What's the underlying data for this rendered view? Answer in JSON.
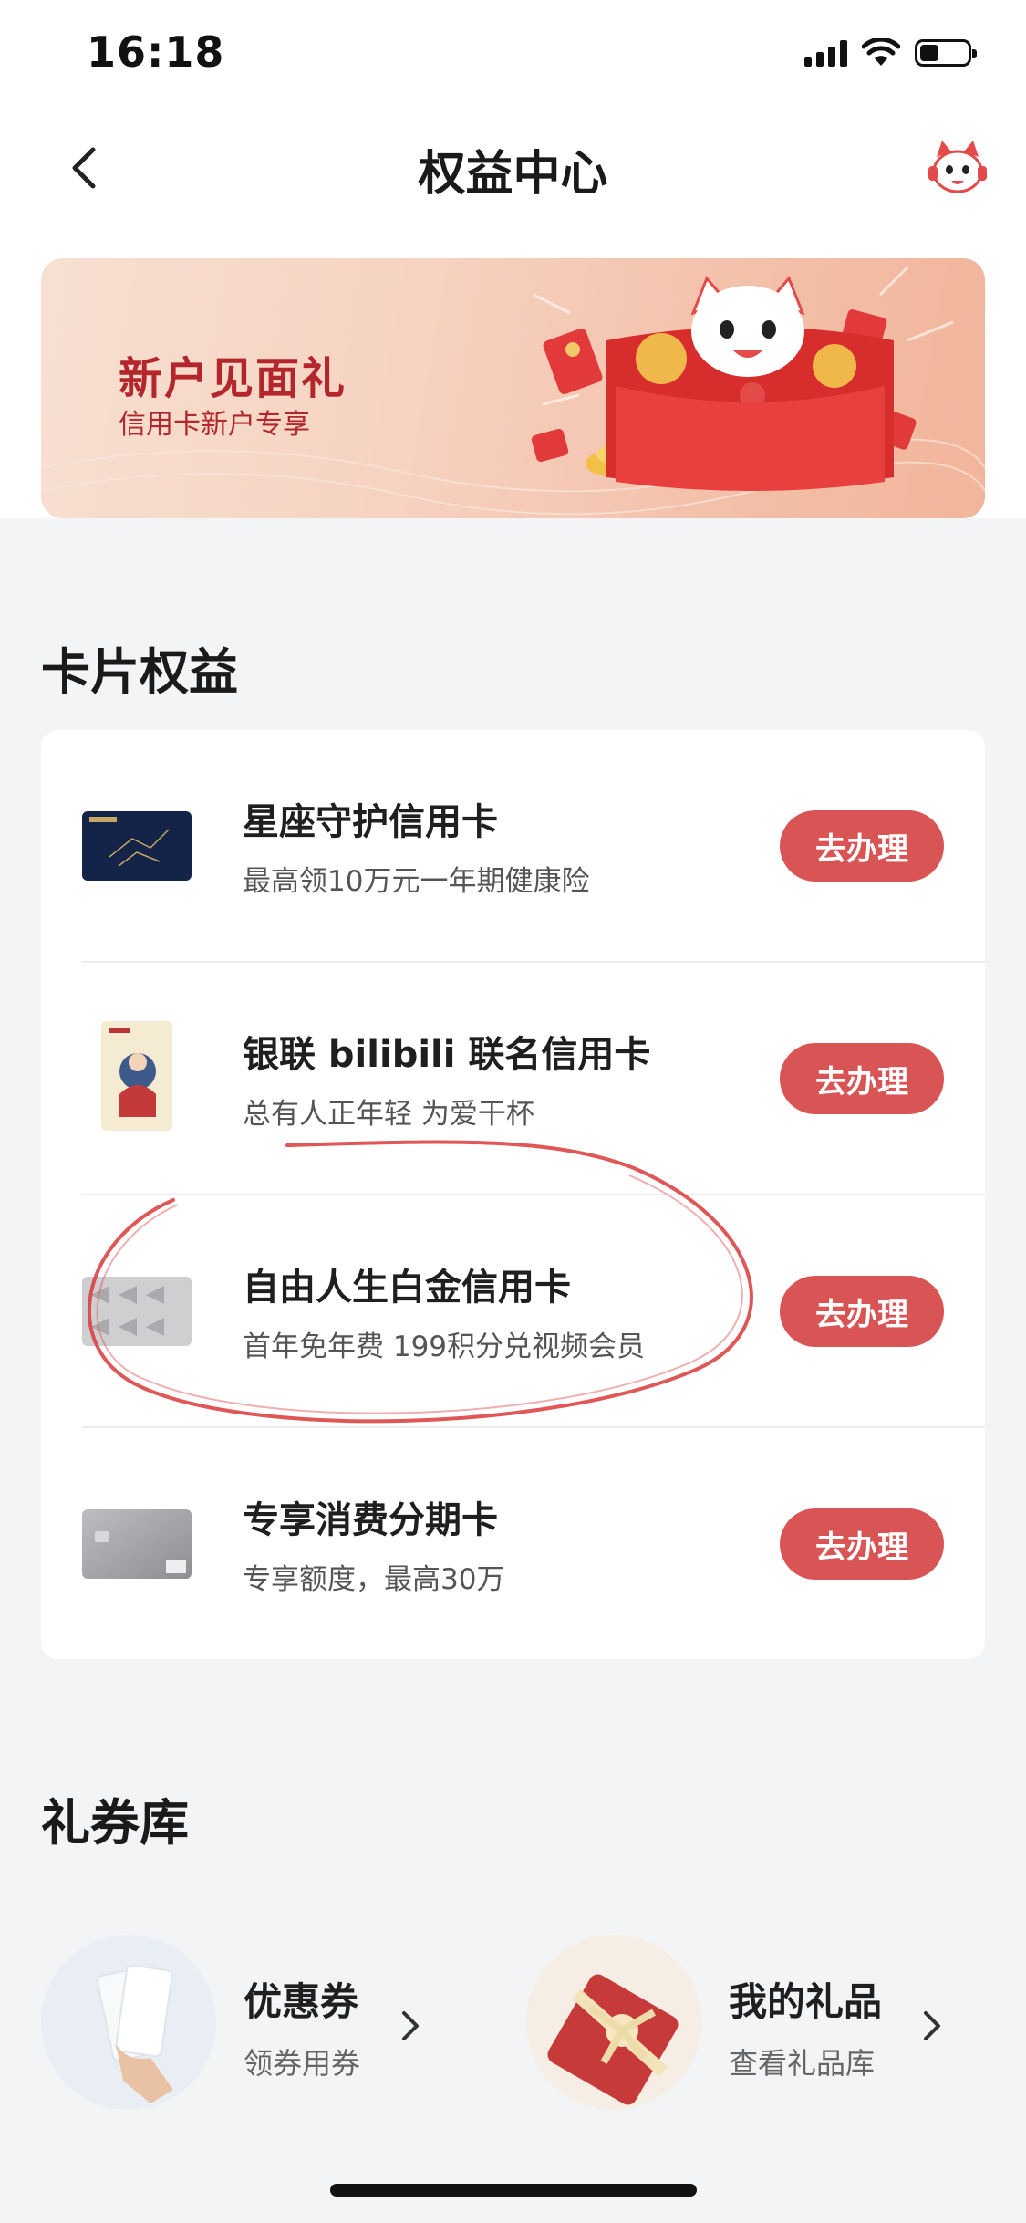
{
  "status_bar": {
    "time": "16:18",
    "battery_level": 0.4
  },
  "nav": {
    "title": "权益中心",
    "back_icon": "chevron-left-icon",
    "mascot_icon": "cat-mascot-icon"
  },
  "banner": {
    "title": "新户见面礼",
    "subtitle": "信用卡新户专享"
  },
  "card_section": {
    "title": "卡片权益",
    "cards": [
      {
        "name": "星座守护信用卡",
        "desc": "最高领10万元一年期健康险",
        "button": "去办理"
      },
      {
        "name": "银联 bilibili 联名信用卡",
        "desc": "总有人正年轻 为爱干杯",
        "button": "去办理"
      },
      {
        "name": "自由人生白金信用卡",
        "desc": "首年免年费 199积分兑视频会员",
        "button": "去办理"
      },
      {
        "name": "专享消费分期卡",
        "desc": "专享额度，最高30万",
        "button": "去办理"
      }
    ]
  },
  "coupon_section": {
    "title": "礼券库",
    "items": [
      {
        "title": "优惠券",
        "subtitle": "领券用券"
      },
      {
        "title": "我的礼品",
        "subtitle": "查看礼品库"
      }
    ]
  },
  "colors": {
    "accent": "#d95555",
    "banner_text": "#b3262c",
    "annotation_red": "#d93a3a"
  }
}
